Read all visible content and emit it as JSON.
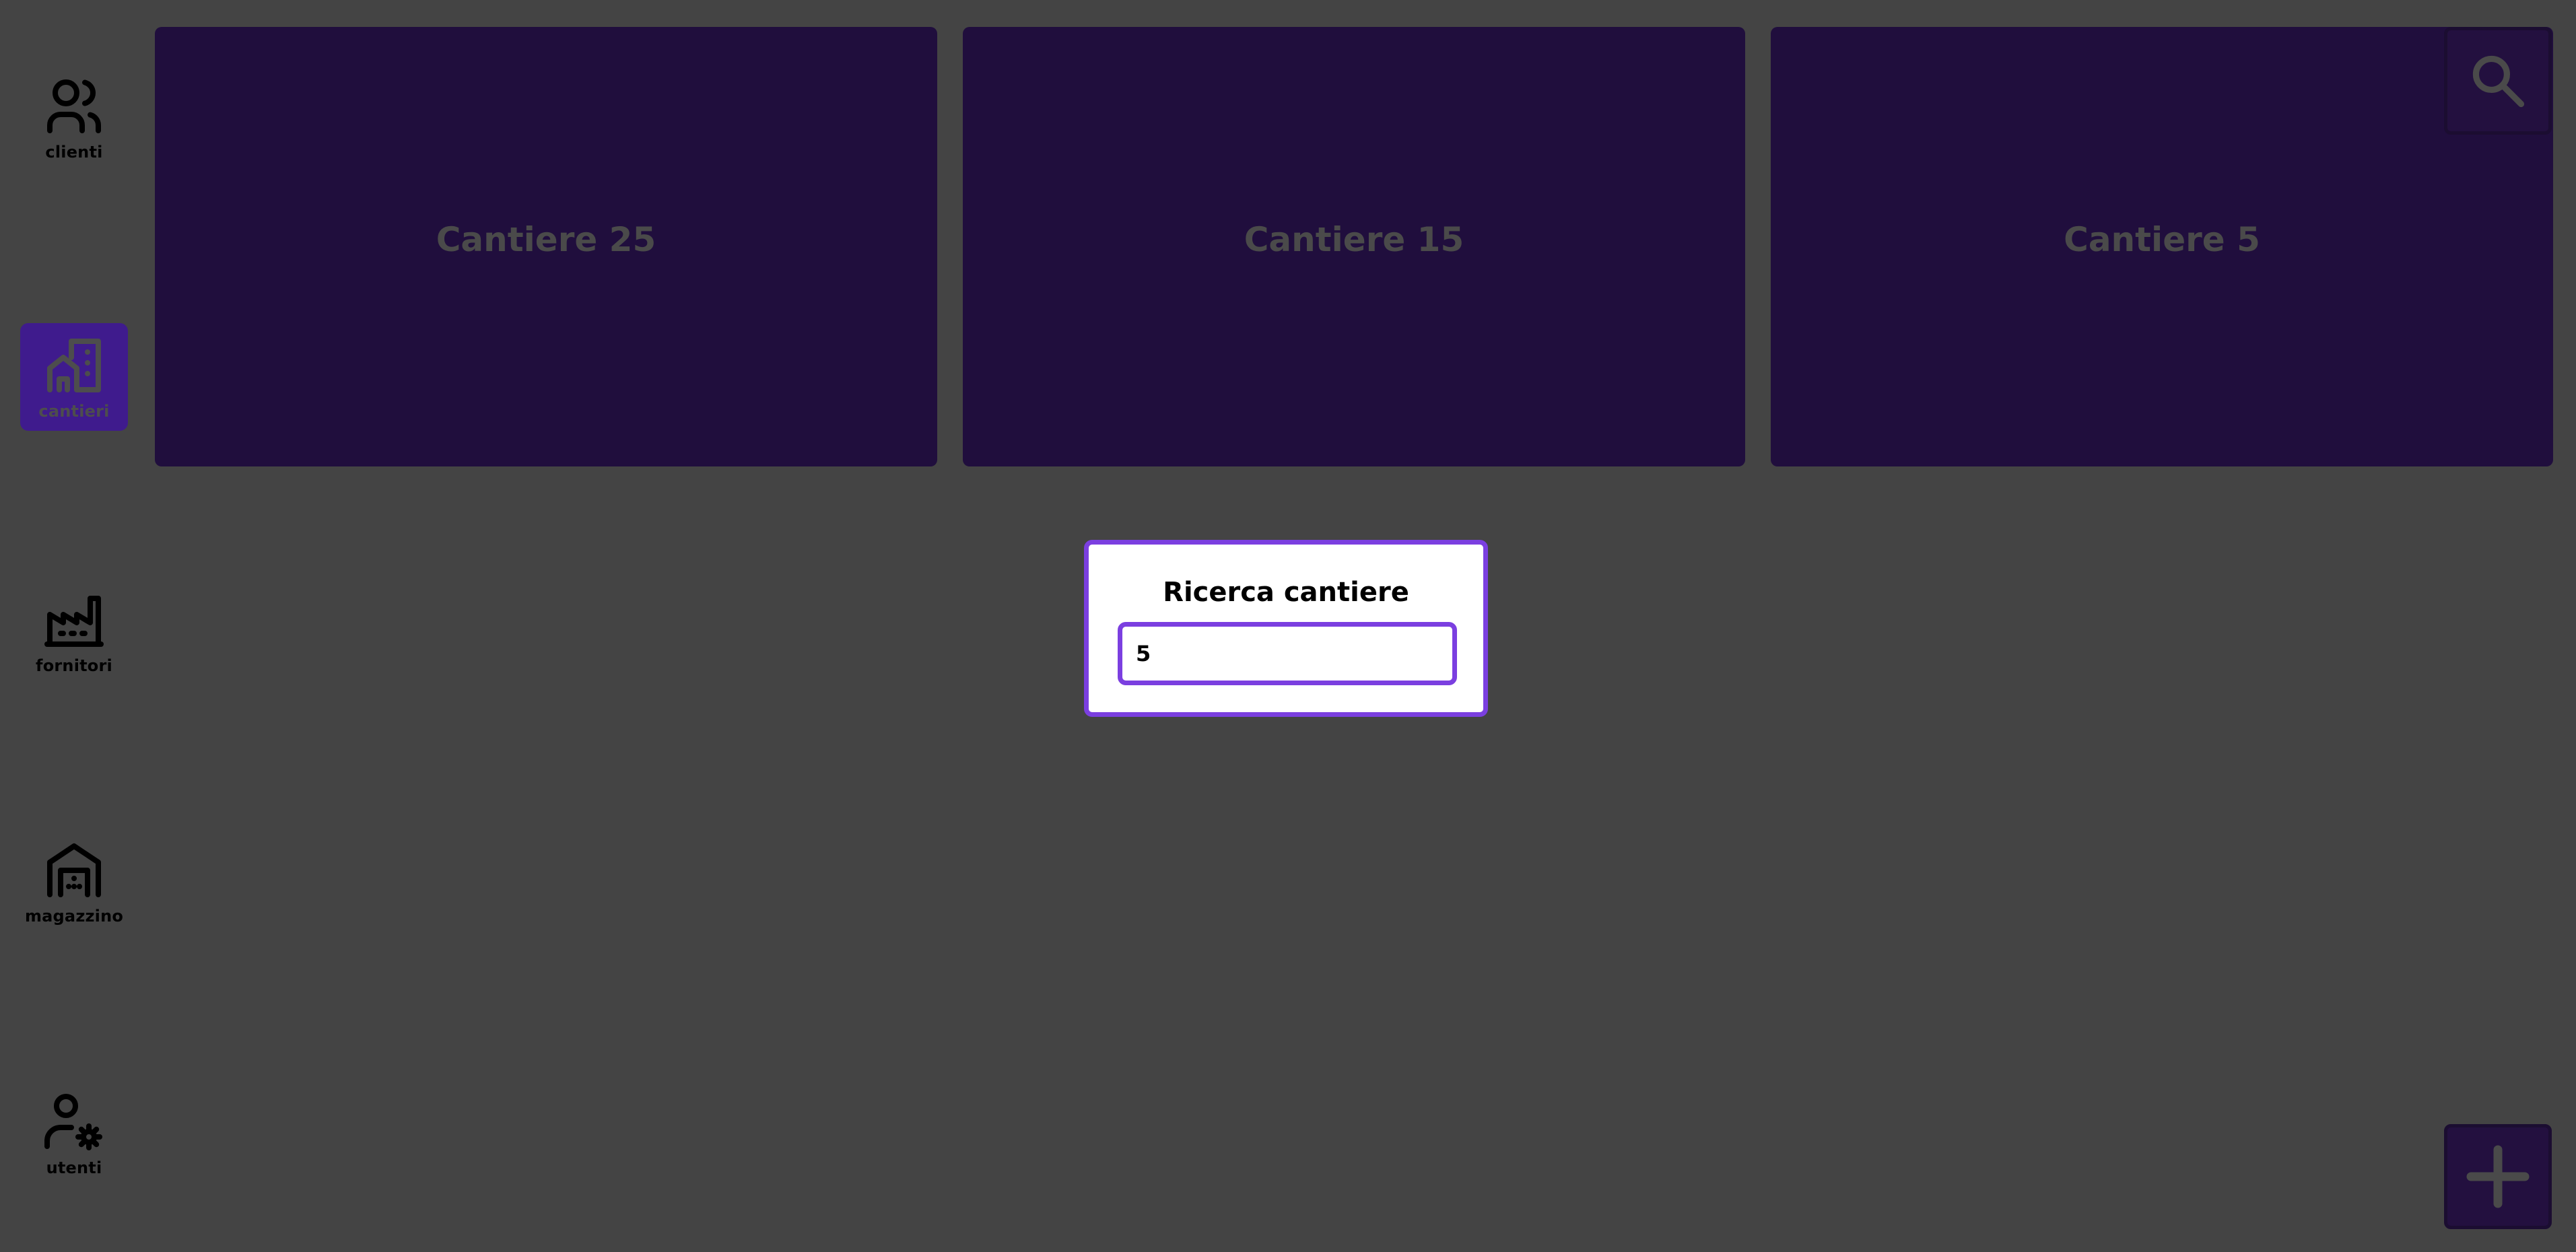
{
  "sidebar": {
    "items": [
      {
        "label": "clienti",
        "icon": "users-icon"
      },
      {
        "label": "cantieri",
        "icon": "building-icon",
        "active": true
      },
      {
        "label": "fornitori",
        "icon": "factory-icon"
      },
      {
        "label": "magazzino",
        "icon": "warehouse-icon"
      },
      {
        "label": "utenti",
        "icon": "user-settings-icon"
      }
    ]
  },
  "cards": [
    {
      "title": "Cantiere 25"
    },
    {
      "title": "Cantiere 15"
    },
    {
      "title": "Cantiere 5"
    }
  ],
  "search_button": {
    "icon": "search-icon"
  },
  "add_button": {
    "icon": "plus-icon"
  },
  "dialog": {
    "title": "Ricerca cantiere",
    "input_value": "5"
  },
  "colors": {
    "background": "#444444",
    "card": "#200e3d",
    "accent": "#7b3fe0",
    "active_nav": "#3f1b8d"
  }
}
